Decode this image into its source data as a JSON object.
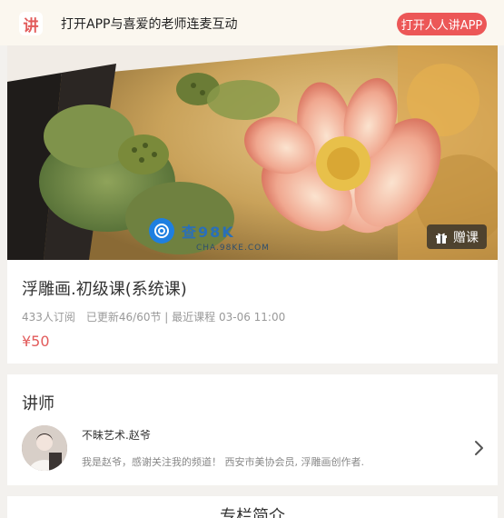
{
  "banner": {
    "logo_char": "讲",
    "message": "打开APP与喜爱的老师连麦互动",
    "open_button": "打开人人讲APP"
  },
  "hero": {
    "gift_label": "赠课",
    "watermark_text": "查98K",
    "watermark_sub": "CHA.98KE.COM"
  },
  "course": {
    "title": "浮雕画.初级课(系统课)",
    "meta": "433人订阅　已更新46/60节 | 最近课程 03-06 11:00",
    "price": "¥50"
  },
  "teacher": {
    "section_title": "讲师",
    "name": "不昧艺术.赵爷",
    "bio": "我是赵爷，感谢关注我的频道！ 西安市美协会员, 浮雕画创作者."
  },
  "intro": {
    "section_title": "专栏简介"
  },
  "colors": {
    "accent": "#ec5757",
    "price": "#e25b5b",
    "banner_bg": "#fbf7ef"
  }
}
